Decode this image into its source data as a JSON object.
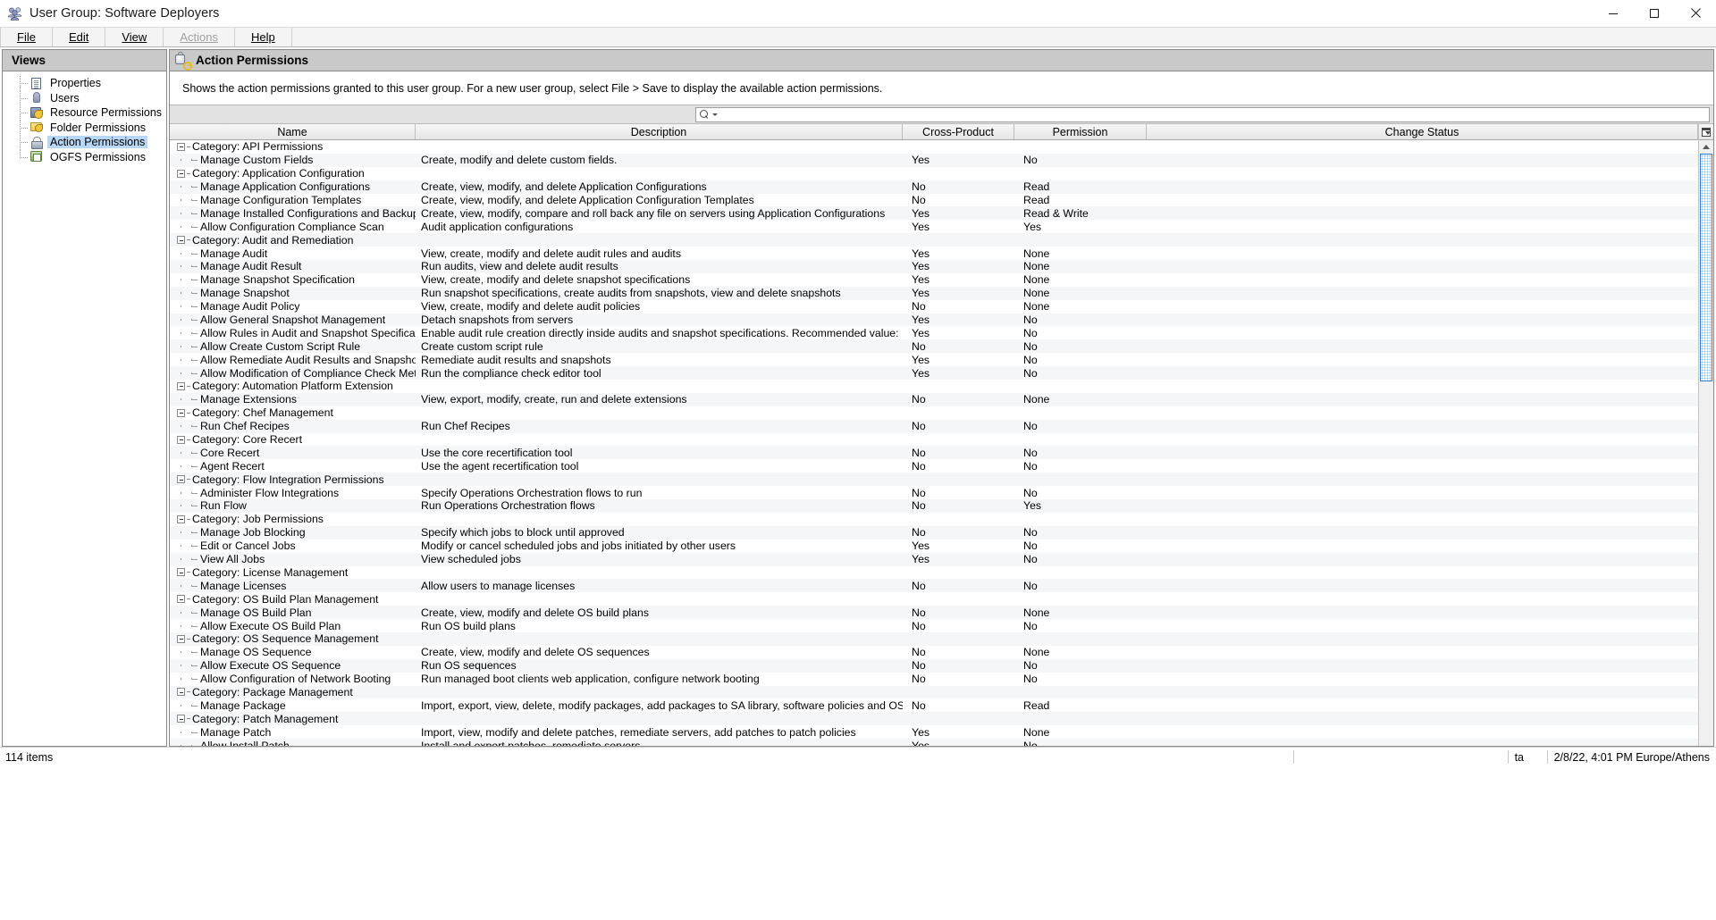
{
  "window": {
    "title": "User Group: Software Deployers",
    "app_icon": "users-group-icon",
    "minimize_label": "Minimize",
    "maximize_label": "Maximize",
    "close_label": "Close"
  },
  "menubar": [
    {
      "label": "File",
      "mnemonic": "F",
      "disabled": false
    },
    {
      "label": "Edit",
      "mnemonic": "E",
      "disabled": false
    },
    {
      "label": "View",
      "mnemonic": "V",
      "disabled": false
    },
    {
      "label": "Actions",
      "mnemonic": "A",
      "disabled": true
    },
    {
      "label": "Help",
      "mnemonic": "H",
      "disabled": false
    }
  ],
  "sidebar": {
    "header": "Views",
    "items": [
      {
        "label": "Properties",
        "icon": "document-icon",
        "selected": false
      },
      {
        "label": "Users",
        "icon": "user-icon",
        "selected": false
      },
      {
        "label": "Resource Permissions",
        "icon": "server-key-icon",
        "selected": false
      },
      {
        "label": "Folder Permissions",
        "icon": "folder-key-icon",
        "selected": false
      },
      {
        "label": "Action Permissions",
        "icon": "lock-key-icon",
        "selected": true
      },
      {
        "label": "OGFS Permissions",
        "icon": "ogfs-icon",
        "selected": false
      }
    ]
  },
  "content": {
    "header": "Action Permissions",
    "header_icon": "lock-key-icon",
    "description": "Shows the action permissions granted to this user group. For a new user group, select File > Save to display the available action permissions.",
    "search": {
      "value": "",
      "placeholder": "",
      "icon": "search-icon"
    },
    "columns": [
      "Name",
      "Description",
      "Cross-Product",
      "Permission",
      "Change Status"
    ],
    "column_options_icon": "column-settings-icon",
    "rows": [
      {
        "type": "category",
        "name": "Category: API Permissions",
        "desc": "",
        "cross": "",
        "perm": "",
        "change": ""
      },
      {
        "type": "item",
        "last": true,
        "name": "Manage Custom Fields",
        "desc": "Create, modify and delete custom fields.",
        "cross": "Yes",
        "perm": "No",
        "change": ""
      },
      {
        "type": "category",
        "name": "Category: Application Configuration",
        "desc": "",
        "cross": "",
        "perm": "",
        "change": ""
      },
      {
        "type": "item",
        "last": false,
        "name": "Manage Application Configurations",
        "desc": "Create, view, modify, and delete Application Configurations",
        "cross": "No",
        "perm": "Read",
        "change": ""
      },
      {
        "type": "item",
        "last": false,
        "name": "Manage Configuration Templates",
        "desc": "Create, view, modify, and delete Application Configuration Templates",
        "cross": "No",
        "perm": "Read",
        "change": ""
      },
      {
        "type": "item",
        "last": false,
        "name": "Manage Installed Configurations and Backups on S...",
        "desc": "Create, view, modify, compare and roll back any file on servers using Application Configurations",
        "cross": "Yes",
        "perm": "Read & Write",
        "change": ""
      },
      {
        "type": "item",
        "last": true,
        "name": "Allow Configuration Compliance Scan",
        "desc": "Audit application configurations",
        "cross": "Yes",
        "perm": "Yes",
        "change": ""
      },
      {
        "type": "category",
        "name": "Category: Audit and Remediation",
        "desc": "",
        "cross": "",
        "perm": "",
        "change": ""
      },
      {
        "type": "item",
        "last": false,
        "name": "Manage Audit",
        "desc": "View, create, modify and delete audit rules and audits",
        "cross": "Yes",
        "perm": "None",
        "change": ""
      },
      {
        "type": "item",
        "last": false,
        "name": "Manage Audit Result",
        "desc": "Run audits, view and delete audit results",
        "cross": "Yes",
        "perm": "None",
        "change": ""
      },
      {
        "type": "item",
        "last": false,
        "name": "Manage Snapshot Specification",
        "desc": "View, create, modify and delete snapshot specifications",
        "cross": "Yes",
        "perm": "None",
        "change": ""
      },
      {
        "type": "item",
        "last": false,
        "name": "Manage Snapshot",
        "desc": "Run snapshot specifications, create audits from snapshots, view and delete snapshots",
        "cross": "Yes",
        "perm": "None",
        "change": ""
      },
      {
        "type": "item",
        "last": false,
        "name": "Manage Audit Policy",
        "desc": "View, create, modify and delete audit policies",
        "cross": "No",
        "perm": "None",
        "change": ""
      },
      {
        "type": "item",
        "last": false,
        "name": "Allow General Snapshot Management",
        "desc": "Detach snapshots from servers",
        "cross": "Yes",
        "perm": "No",
        "change": ""
      },
      {
        "type": "item",
        "last": false,
        "name": "Allow Rules in Audit and Snapshot Specification",
        "desc": "Enable audit rule creation directly inside audits and snapshot specifications. Recommended value: No",
        "cross": "Yes",
        "perm": "No",
        "change": ""
      },
      {
        "type": "item",
        "last": false,
        "name": "Allow Create Custom Script Rule",
        "desc": "Create custom script rule",
        "cross": "No",
        "perm": "No",
        "change": ""
      },
      {
        "type": "item",
        "last": false,
        "name": "Allow Remediate Audit Results and Snapshots",
        "desc": "Remediate audit results and snapshots",
        "cross": "Yes",
        "perm": "No",
        "change": ""
      },
      {
        "type": "item",
        "last": true,
        "name": "Allow Modification of Compliance Check Metadata",
        "desc": "Run the compliance check editor tool",
        "cross": "Yes",
        "perm": "No",
        "change": ""
      },
      {
        "type": "category",
        "name": "Category: Automation Platform Extension",
        "desc": "",
        "cross": "",
        "perm": "",
        "change": ""
      },
      {
        "type": "item",
        "last": true,
        "name": "Manage Extensions",
        "desc": "View, export, modify, create, run and delete extensions",
        "cross": "No",
        "perm": "None",
        "change": ""
      },
      {
        "type": "category",
        "name": "Category: Chef Management",
        "desc": "",
        "cross": "",
        "perm": "",
        "change": ""
      },
      {
        "type": "item",
        "last": true,
        "name": "Run Chef Recipes",
        "desc": "Run Chef Recipes",
        "cross": "No",
        "perm": "No",
        "change": ""
      },
      {
        "type": "category",
        "name": "Category: Core Recert",
        "desc": "",
        "cross": "",
        "perm": "",
        "change": ""
      },
      {
        "type": "item",
        "last": false,
        "name": "Core Recert",
        "desc": "Use the core recertification tool",
        "cross": "No",
        "perm": "No",
        "change": ""
      },
      {
        "type": "item",
        "last": true,
        "name": "Agent Recert",
        "desc": "Use the agent recertification tool",
        "cross": "No",
        "perm": "No",
        "change": ""
      },
      {
        "type": "category",
        "name": "Category: Flow Integration Permissions",
        "desc": "",
        "cross": "",
        "perm": "",
        "change": ""
      },
      {
        "type": "item",
        "last": false,
        "name": "Administer Flow Integrations",
        "desc": "Specify Operations Orchestration flows to run",
        "cross": "No",
        "perm": "No",
        "change": ""
      },
      {
        "type": "item",
        "last": true,
        "name": "Run Flow",
        "desc": "Run Operations Orchestration flows",
        "cross": "No",
        "perm": "Yes",
        "change": ""
      },
      {
        "type": "category",
        "name": "Category: Job Permissions",
        "desc": "",
        "cross": "",
        "perm": "",
        "change": ""
      },
      {
        "type": "item",
        "last": false,
        "name": "Manage Job Blocking",
        "desc": "Specify which jobs to block until approved",
        "cross": "No",
        "perm": "No",
        "change": ""
      },
      {
        "type": "item",
        "last": false,
        "name": "Edit or Cancel Jobs",
        "desc": "Modify or cancel scheduled jobs and jobs initiated by other users",
        "cross": "Yes",
        "perm": "No",
        "change": ""
      },
      {
        "type": "item",
        "last": true,
        "name": "View All Jobs",
        "desc": "View scheduled jobs",
        "cross": "Yes",
        "perm": "No",
        "change": ""
      },
      {
        "type": "category",
        "name": "Category: License Management",
        "desc": "",
        "cross": "",
        "perm": "",
        "change": ""
      },
      {
        "type": "item",
        "last": true,
        "name": "Manage Licenses",
        "desc": "Allow users to manage licenses",
        "cross": "No",
        "perm": "No",
        "change": ""
      },
      {
        "type": "category",
        "name": "Category: OS Build Plan Management",
        "desc": "",
        "cross": "",
        "perm": "",
        "change": ""
      },
      {
        "type": "item",
        "last": false,
        "name": "Manage OS Build Plan",
        "desc": "Create, view, modify and delete OS build plans",
        "cross": "No",
        "perm": "None",
        "change": ""
      },
      {
        "type": "item",
        "last": true,
        "name": "Allow Execute OS Build Plan",
        "desc": "Run OS build plans",
        "cross": "No",
        "perm": "No",
        "change": ""
      },
      {
        "type": "category",
        "name": "Category: OS Sequence Management",
        "desc": "",
        "cross": "",
        "perm": "",
        "change": ""
      },
      {
        "type": "item",
        "last": false,
        "name": "Manage OS Sequence",
        "desc": "Create, view, modify and delete OS sequences",
        "cross": "No",
        "perm": "None",
        "change": ""
      },
      {
        "type": "item",
        "last": false,
        "name": "Allow Execute OS Sequence",
        "desc": "Run OS sequences",
        "cross": "No",
        "perm": "No",
        "change": ""
      },
      {
        "type": "item",
        "last": true,
        "name": "Allow Configuration of Network Booting",
        "desc": "Run managed boot clients web application, configure network booting",
        "cross": "No",
        "perm": "No",
        "change": ""
      },
      {
        "type": "category",
        "name": "Category: Package Management",
        "desc": "",
        "cross": "",
        "perm": "",
        "change": ""
      },
      {
        "type": "item",
        "last": true,
        "name": "Manage Package",
        "desc": "Import, export, view, delete, modify packages, add packages to SA library, software policies and OS build plans",
        "cross": "No",
        "perm": "Read",
        "change": ""
      },
      {
        "type": "category",
        "name": "Category: Patch Management",
        "desc": "",
        "cross": "",
        "perm": "",
        "change": ""
      },
      {
        "type": "item",
        "last": false,
        "name": "Manage Patch",
        "desc": "Import, view, modify and delete patches, remediate servers, add patches to patch policies",
        "cross": "Yes",
        "perm": "None",
        "change": ""
      },
      {
        "type": "item",
        "last": false,
        "name": "Allow Install Patch",
        "desc": "Install and export patches, remediate servers",
        "cross": "Yes",
        "perm": "No",
        "change": ""
      }
    ]
  },
  "statusbar": {
    "items_count": "114 items",
    "locale_short": "ta",
    "timestamp": "2/8/22, 4:01 PM Europe/Athens"
  }
}
